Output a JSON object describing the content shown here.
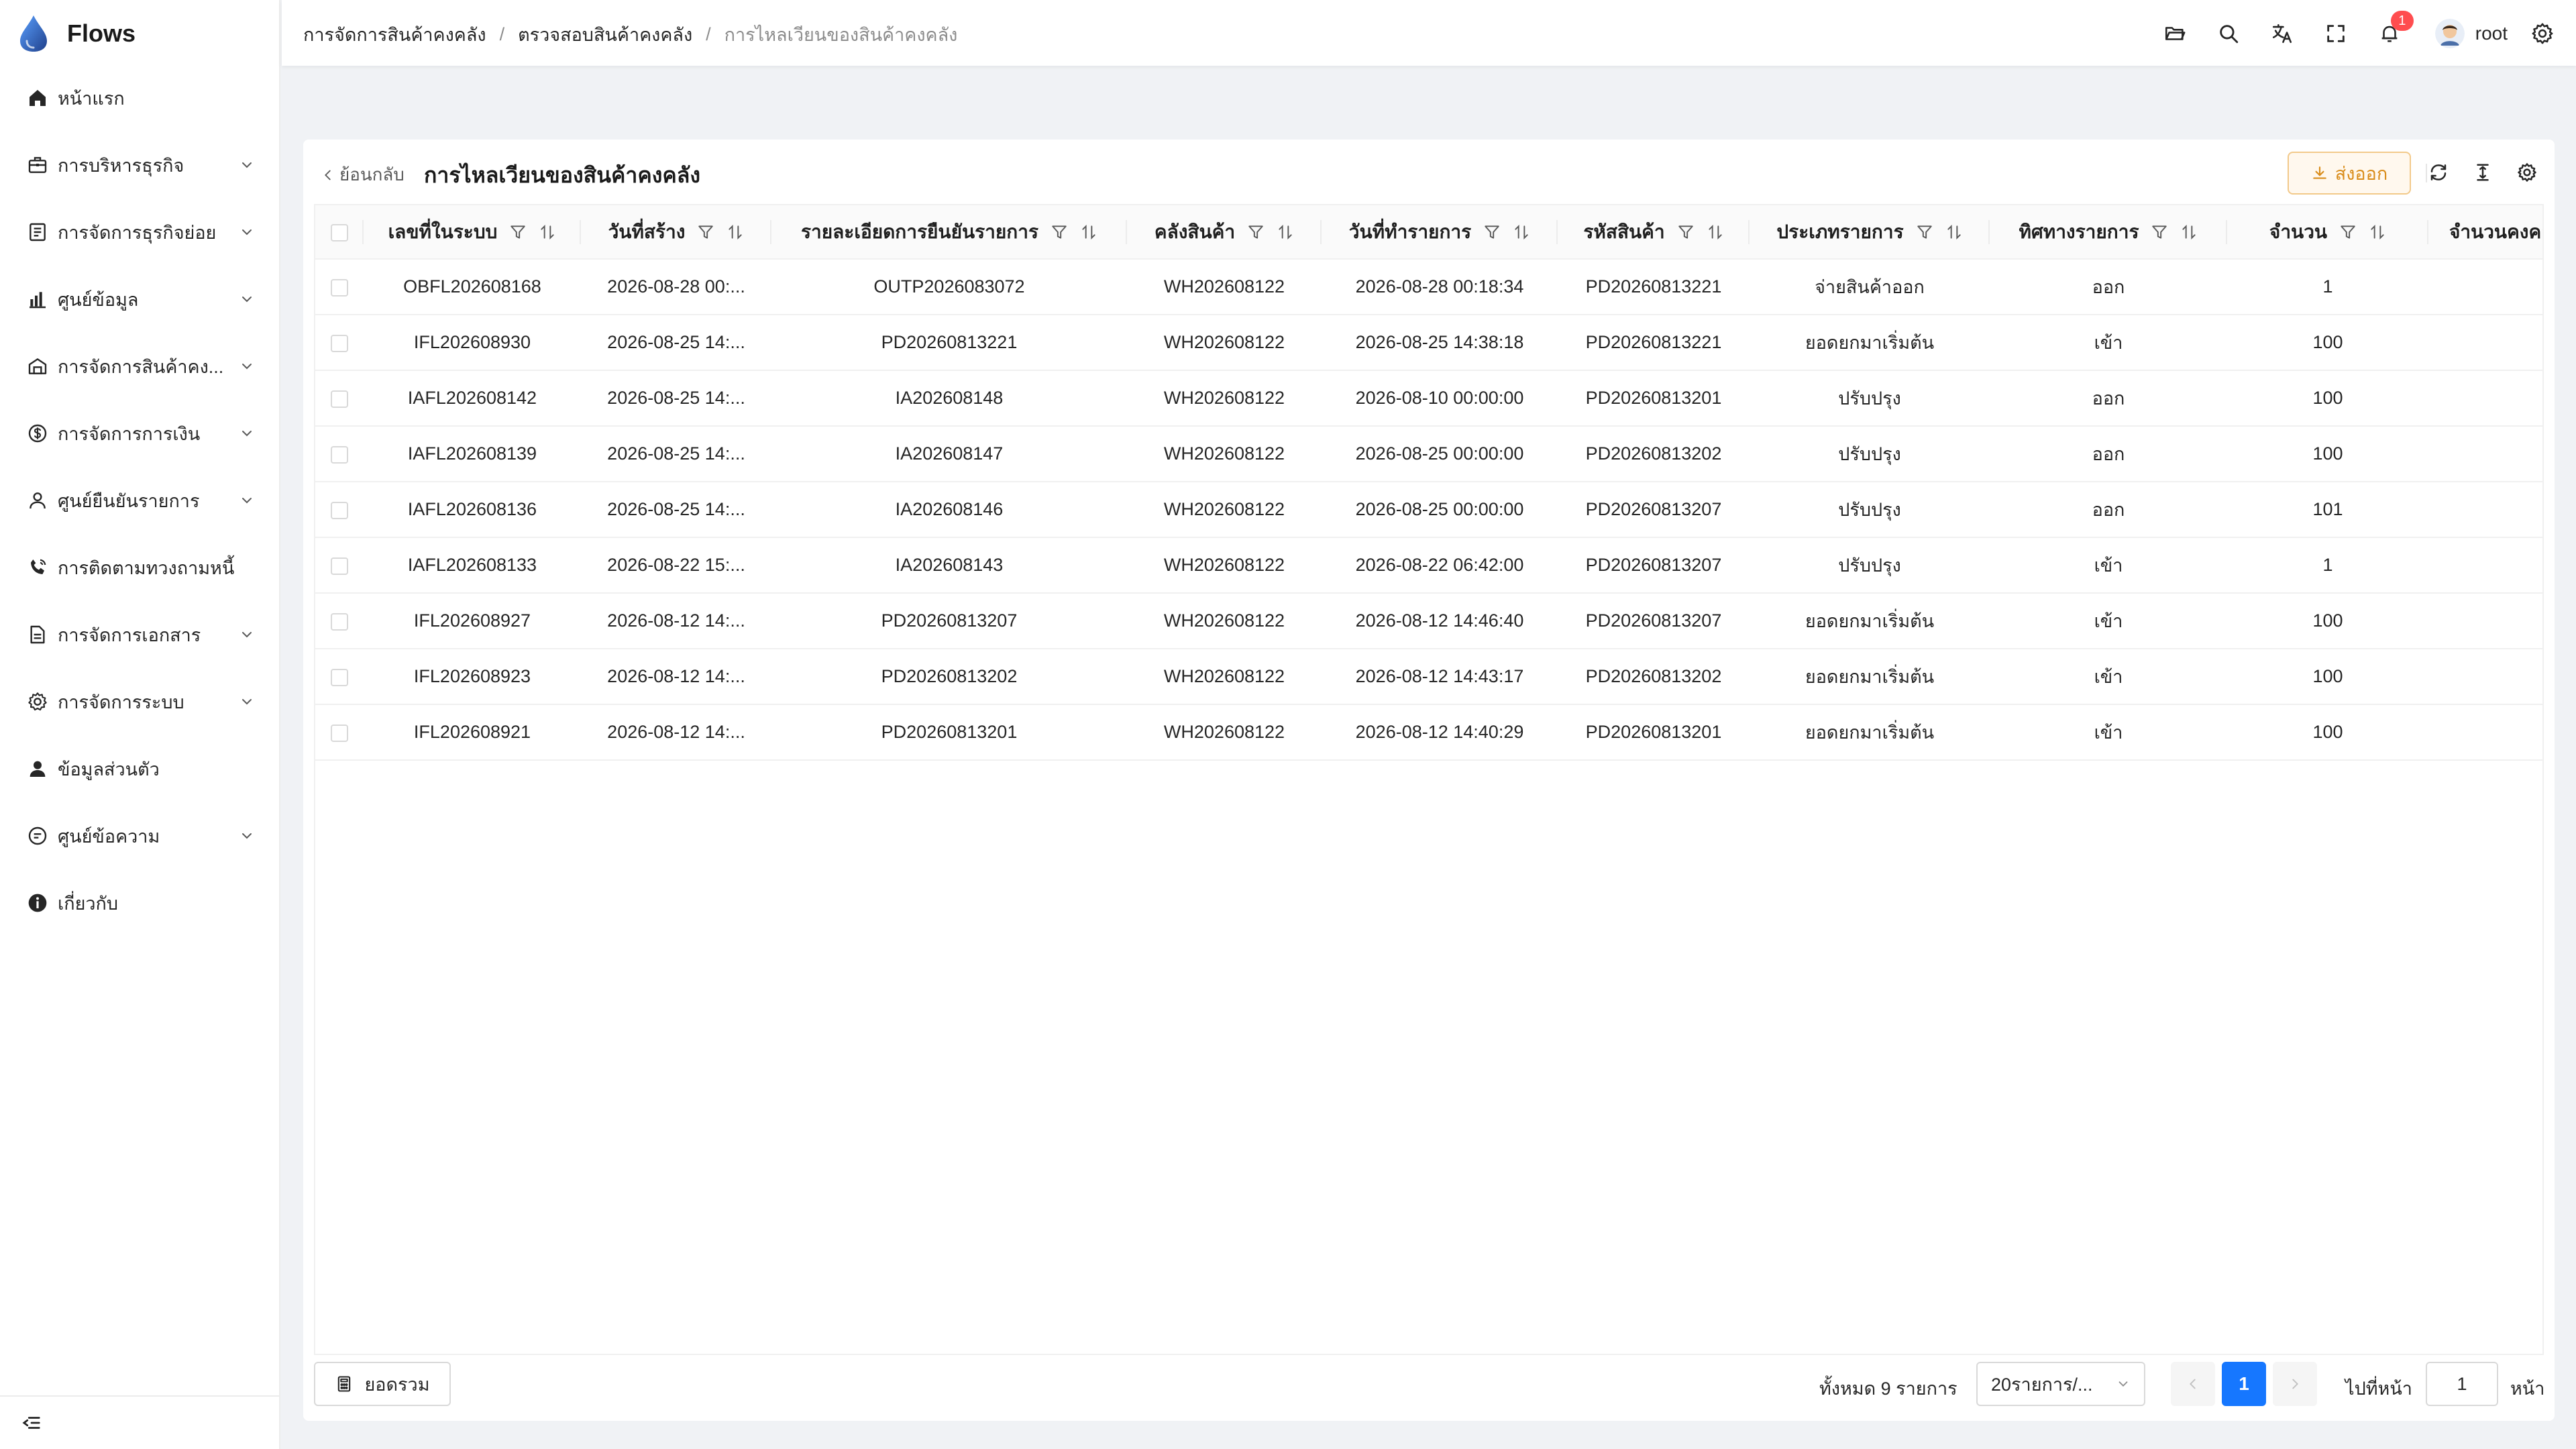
{
  "app": {
    "name": "Flows"
  },
  "sidebar": {
    "items": [
      {
        "label": "หน้าแรก",
        "icon": "home-icon",
        "expandable": false
      },
      {
        "label": "การบริหารธุรกิจ",
        "icon": "briefcase-icon",
        "expandable": true
      },
      {
        "label": "การจัดการธุรกิจย่อย",
        "icon": "document-list-icon",
        "expandable": true
      },
      {
        "label": "ศูนย์ข้อมูล",
        "icon": "bar-chart-icon",
        "expandable": true
      },
      {
        "label": "การจัดการสินค้าคง...",
        "icon": "warehouse-icon",
        "expandable": true
      },
      {
        "label": "การจัดการการเงิน",
        "icon": "dollar-circle-icon",
        "expandable": true
      },
      {
        "label": "ศูนย์ยืนยันรายการ",
        "icon": "user-check-icon",
        "expandable": true
      },
      {
        "label": "การติดตามทวงถามหนี้",
        "icon": "phone-call-icon",
        "expandable": false
      },
      {
        "label": "การจัดการเอกสาร",
        "icon": "document-icon",
        "expandable": true
      },
      {
        "label": "การจัดการระบบ",
        "icon": "settings-icon",
        "expandable": true
      },
      {
        "label": "ข้อมูลส่วนตัว",
        "icon": "user-icon",
        "expandable": false
      },
      {
        "label": "ศูนย์ข้อความ",
        "icon": "message-icon",
        "expandable": true
      },
      {
        "label": "เกี่ยวกับ",
        "icon": "info-icon",
        "expandable": false
      }
    ]
  },
  "header": {
    "breadcrumb": [
      "การจัดการสินค้าคงคลัง",
      "ตรวจสอบสินค้าคงคลัง",
      "การไหลเวียนของสินค้าคงคลัง"
    ],
    "notification_count": "1",
    "user": "root"
  },
  "page": {
    "back_label": "ย้อนกลับ",
    "title": "การไหลเวียนของสินค้าคงคลัง",
    "export_label": "ส่งออก"
  },
  "table": {
    "columns": [
      "เลขที่ในระบบ",
      "วันที่สร้าง",
      "รายละเอียดการยืนยันรายการ",
      "คลังสินค้า",
      "วันที่ทำรายการ",
      "รหัสสินค้า",
      "ประเภทรายการ",
      "ทิศทางรายการ",
      "จำนวน",
      "จำนวนคงคลัง"
    ],
    "rows": [
      [
        "OBFL202608168",
        "2026-08-28 00:...",
        "OUTP2026083072",
        "WH202608122",
        "2026-08-28 00:18:34",
        "PD20260813221",
        "จ่ายสินค้าออก",
        "ออก",
        "1",
        ""
      ],
      [
        "IFL202608930",
        "2026-08-25 14:...",
        "PD20260813221",
        "WH202608122",
        "2026-08-25 14:38:18",
        "PD20260813221",
        "ยอดยกมาเริ่มต้น",
        "เข้า",
        "100",
        ""
      ],
      [
        "IAFL202608142",
        "2026-08-25 14:...",
        "IA202608148",
        "WH202608122",
        "2026-08-10 00:00:00",
        "PD20260813201",
        "ปรับปรุง",
        "ออก",
        "100",
        ""
      ],
      [
        "IAFL202608139",
        "2026-08-25 14:...",
        "IA202608147",
        "WH202608122",
        "2026-08-25 00:00:00",
        "PD20260813202",
        "ปรับปรุง",
        "ออก",
        "100",
        ""
      ],
      [
        "IAFL202608136",
        "2026-08-25 14:...",
        "IA202608146",
        "WH202608122",
        "2026-08-25 00:00:00",
        "PD20260813207",
        "ปรับปรุง",
        "ออก",
        "101",
        ""
      ],
      [
        "IAFL202608133",
        "2026-08-22 15:...",
        "IA202608143",
        "WH202608122",
        "2026-08-22 06:42:00",
        "PD20260813207",
        "ปรับปรุง",
        "เข้า",
        "1",
        ""
      ],
      [
        "IFL202608927",
        "2026-08-12 14:...",
        "PD20260813207",
        "WH202608122",
        "2026-08-12 14:46:40",
        "PD20260813207",
        "ยอดยกมาเริ่มต้น",
        "เข้า",
        "100",
        ""
      ],
      [
        "IFL202608923",
        "2026-08-12 14:...",
        "PD20260813202",
        "WH202608122",
        "2026-08-12 14:43:17",
        "PD20260813202",
        "ยอดยกมาเริ่มต้น",
        "เข้า",
        "100",
        ""
      ],
      [
        "IFL202608921",
        "2026-08-12 14:...",
        "PD20260813201",
        "WH202608122",
        "2026-08-12 14:40:29",
        "PD20260813201",
        "ยอดยกมาเริ่มต้น",
        "เข้า",
        "100",
        ""
      ]
    ]
  },
  "footer": {
    "summary_label": "ยอดรวม",
    "total_text": "ทั้งหมด 9 รายการ",
    "page_size": "20รายการ/...",
    "current_page": "1",
    "goto_label": "ไปที่หน้า",
    "goto_value": "1",
    "goto_suffix": "หน้า"
  },
  "colors": {
    "primary": "#1677ff",
    "export_accent": "#d98c1a",
    "badge": "#ff4d4f",
    "logo_drop": "#2f6fd6"
  }
}
